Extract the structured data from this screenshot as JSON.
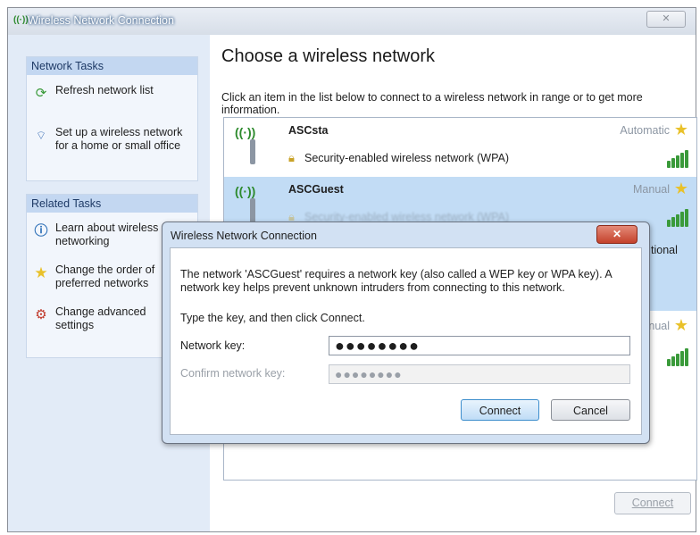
{
  "window": {
    "title": "Wireless Network Connection",
    "close_glyph": "✕"
  },
  "sidebar": {
    "network_tasks": {
      "header": "Network Tasks",
      "items": [
        {
          "label": "Refresh network list",
          "icon": "refresh-icon"
        },
        {
          "label": "Set up a wireless network for a home or small office",
          "icon": "wireless-setup-icon"
        }
      ]
    },
    "related_tasks": {
      "header": "Related Tasks",
      "items": [
        {
          "label": "Learn about wireless networking",
          "icon": "info-icon"
        },
        {
          "label": "Change the order of preferred networks",
          "icon": "star-icon"
        },
        {
          "label": "Change advanced settings",
          "icon": "settings-icon"
        }
      ]
    }
  },
  "main": {
    "heading": "Choose a wireless network",
    "intro": "Click an item in the list below to connect to a wireless network in range or to get more information.",
    "networks": [
      {
        "name": "ASCsta",
        "mode": "Automatic",
        "security": "Security-enabled wireless network (WPA)",
        "signal": 5,
        "selected": false
      },
      {
        "name": "ASCGuest",
        "mode": "Manual",
        "security": "Security-enabled wireless network (WPA)",
        "signal": 5,
        "selected": true
      },
      {
        "name": "",
        "mode": "Manual",
        "security": "",
        "signal": 5,
        "selected": false
      }
    ],
    "partial_text_tional": "tional",
    "connect_label": "Connect"
  },
  "dialog": {
    "title": "Wireless Network Connection",
    "close_glyph": "✕",
    "message": "The network 'ASCGuest' requires a network key (also called a WEP key or WPA key). A network key helps prevent unknown intruders from connecting to this network.",
    "instruction": "Type the key, and then click Connect.",
    "network_key_label": "Network key:",
    "network_key_value": "●●●●●●●●",
    "confirm_key_label": "Confirm network key:",
    "confirm_key_value": "●●●●●●●●",
    "connect_label": "Connect",
    "cancel_label": "Cancel"
  },
  "colors": {
    "accent": "#3c8dcc",
    "selected_row": "#c2dcf5",
    "pane": "#e2ebf7",
    "close_red": "#c4422c"
  }
}
